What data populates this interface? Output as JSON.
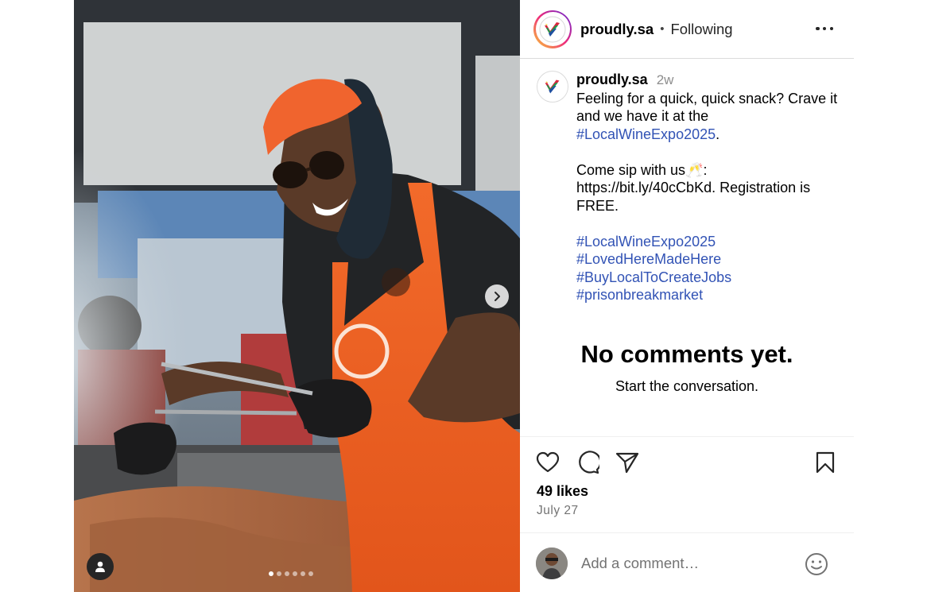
{
  "post": {
    "username": "proudly.sa",
    "separator": "•",
    "follow_status": "Following",
    "more_icon": "more-horizontal-icon"
  },
  "caption": {
    "username": "proudly.sa",
    "time": "2w",
    "line1": "Feeling for a quick, quick snack? Crave it and we have it at the ",
    "hashtag_inline": "#LocalWineExpo2025",
    "line1_end": ".",
    "line2_start": "Come sip with us",
    "line2_emoji": "🥂",
    "line2_rest": ": https://bit.ly/40cCbKd. Registration is FREE.",
    "hashtags": [
      "#LocalWineExpo2025",
      "#LovedHereMadeHere",
      "#BuyLocalToCreateJobs",
      "#prisonbreakmarket"
    ]
  },
  "comments": {
    "empty_title": "No comments yet.",
    "empty_subtitle": "Start the conversation."
  },
  "actions": {
    "like_icon": "heart-icon",
    "comment_icon": "comment-icon",
    "share_icon": "share-icon",
    "save_icon": "bookmark-icon"
  },
  "likes": "49 likes",
  "date": "July 27",
  "add_comment": {
    "placeholder": "Add a comment…",
    "emoji_icon": "smiley-icon"
  },
  "carousel": {
    "slide_count": 6,
    "active_index": 0,
    "next_icon": "chevron-right-icon",
    "tag_icon": "user-tag-icon"
  },
  "colors": {
    "hashtag": "#3253b5",
    "secondary_text": "#737373",
    "divider": "#dbdbdb"
  }
}
